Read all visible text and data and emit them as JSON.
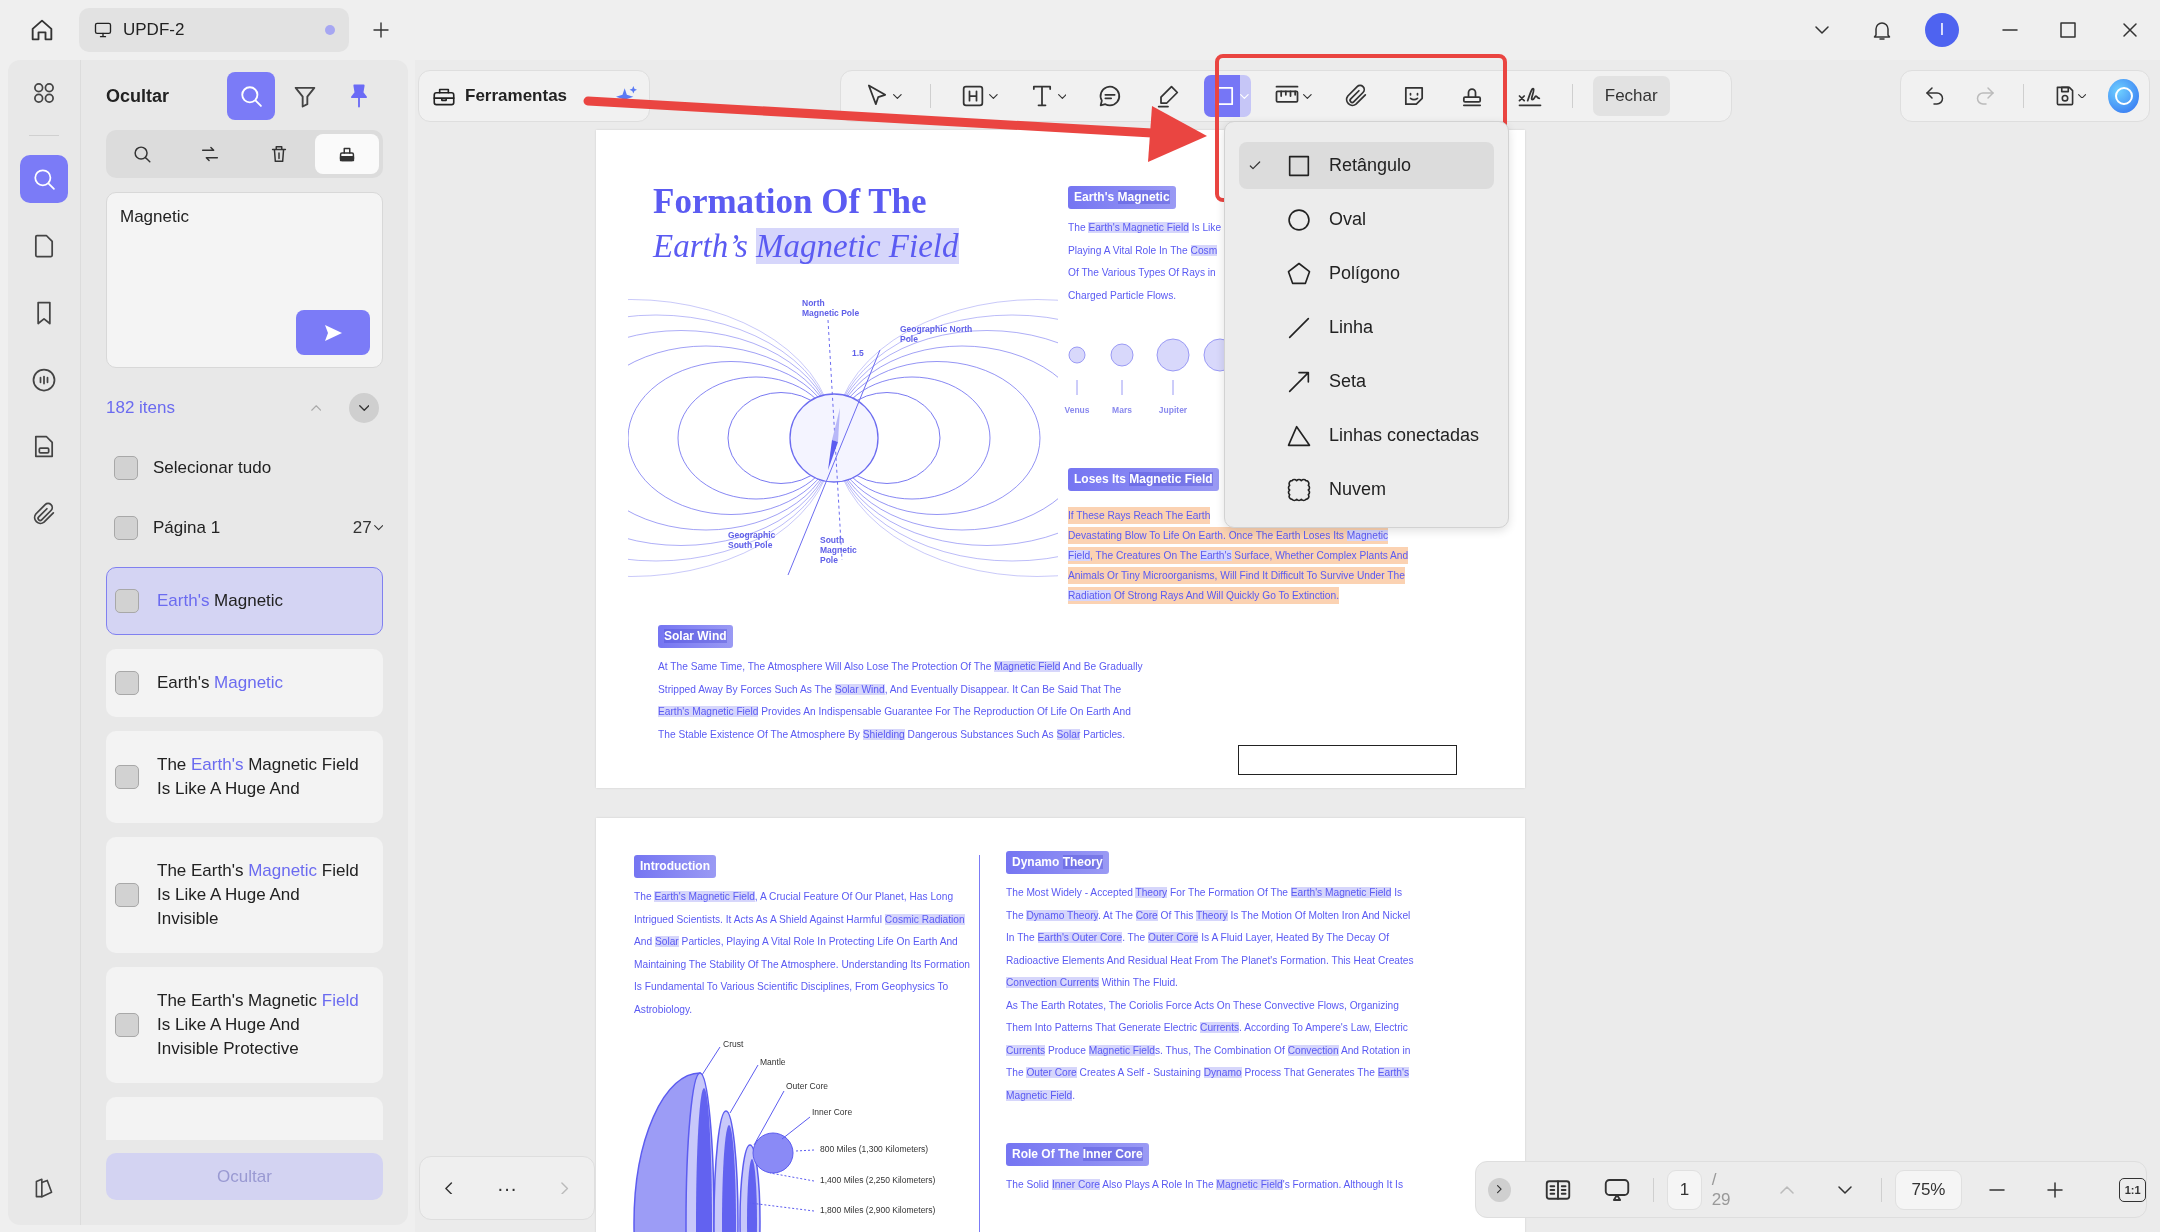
{
  "title_bar": {
    "tab": {
      "title": "UPDF-2",
      "modified": true
    },
    "avatar": "I"
  },
  "rail": {
    "items": [
      {
        "kind": "thumbnails",
        "selected": false
      },
      {
        "kind": "search",
        "selected": true
      },
      {
        "kind": "pages",
        "selected": false
      },
      {
        "kind": "bookmarks",
        "selected": false
      },
      {
        "kind": "comments",
        "selected": false
      },
      {
        "kind": "forms",
        "selected": false
      },
      {
        "kind": "attachments",
        "selected": false
      }
    ]
  },
  "panel": {
    "title": "Ocultar",
    "actions": [
      {
        "kind": "search",
        "selected": true
      },
      {
        "kind": "filter",
        "selected": false
      },
      {
        "kind": "pin",
        "selected": true
      }
    ],
    "modes": [
      {
        "kind": "search",
        "selected": false
      },
      {
        "kind": "replace",
        "selected": false
      },
      {
        "kind": "delete",
        "selected": false
      },
      {
        "kind": "redact",
        "selected": true
      }
    ],
    "query": "Magnetic",
    "count": "182 itens",
    "select_all": {
      "label": "Selecionar tudo",
      "checked": false
    },
    "page_group": {
      "label": "Página 1",
      "count": "27",
      "checked": false
    },
    "results": [
      {
        "segments": [
          {
            "text": "Earth's",
            "match": true
          },
          " Magnetic"
        ],
        "checked": false,
        "selected": true
      },
      {
        "segments": [
          "Earth's ",
          {
            "text": "Magnetic",
            "match": true
          }
        ],
        "checked": false,
        "selected": false
      },
      {
        "segments": [
          "The ",
          {
            "text": "Earth's",
            "match": true
          },
          " Magnetic Field Is Like A Huge And"
        ],
        "checked": false,
        "selected": false
      },
      {
        "segments": [
          "The Earth's ",
          {
            "text": "Magnetic",
            "match": true
          },
          " Field Is Like A Huge And Invisible"
        ],
        "checked": false,
        "selected": false
      },
      {
        "segments": [
          "The Earth's Magnetic ",
          {
            "text": "Field",
            "match": true
          },
          " Is Like A Huge And Invisible Protective"
        ],
        "checked": false,
        "selected": false
      }
    ],
    "hide_button": {
      "label": "Ocultar",
      "disabled": true
    }
  },
  "toolbar": {
    "tools_button": "Ferramentas",
    "tools": [
      {
        "kind": "select",
        "menu": true,
        "selected": false
      },
      {
        "kind": "textbox",
        "menu": true,
        "selected": false
      },
      {
        "kind": "text",
        "menu": true,
        "selected": false
      },
      {
        "kind": "comment",
        "menu": false,
        "selected": false
      },
      {
        "kind": "highlight",
        "menu": false,
        "selected": false
      },
      {
        "kind": "shape",
        "menu": true,
        "selected": true
      },
      {
        "kind": "measure",
        "menu": true,
        "selected": false
      },
      {
        "kind": "attach",
        "menu": false,
        "selected": false
      },
      {
        "kind": "sticker",
        "menu": false,
        "selected": false
      },
      {
        "kind": "stamp",
        "menu": false,
        "selected": false
      },
      {
        "kind": "signature",
        "menu": false,
        "selected": false
      }
    ],
    "close": "Fechar",
    "history": [
      {
        "kind": "undo",
        "disabled": false
      },
      {
        "kind": "redo",
        "disabled": true
      }
    ]
  },
  "shape_menu": {
    "items": [
      {
        "kind": "rectangle",
        "label": "Retângulo",
        "selected": true
      },
      {
        "kind": "oval",
        "label": "Oval",
        "selected": false
      },
      {
        "kind": "polygon",
        "label": "Polígono",
        "selected": false
      },
      {
        "kind": "line",
        "label": "Linha",
        "selected": false
      },
      {
        "kind": "arrow",
        "label": "Seta",
        "selected": false
      },
      {
        "kind": "polyline",
        "label": "Linhas conectadas",
        "selected": false
      },
      {
        "kind": "cloud",
        "label": "Nuvem",
        "selected": false
      }
    ]
  },
  "pages": [
    {
      "kind": "cover",
      "title": "Formation Of The",
      "subtitle": [
        "Earth’s ",
        {
          "text": "Magnetic Field",
          "highlighted": true
        }
      ],
      "field_labels": [
        "North Magnetic Pole",
        "Geographic North Pole",
        "1.5",
        "Geographic South Pole",
        "South Magnetic Pole"
      ],
      "planets": [
        "Venus",
        "Mars",
        "Jupiter"
      ],
      "sections": [
        {
          "heading": [
            "Earth's ",
            {
              "text": "Magnetic",
              "highlighted": true
            }
          ],
          "marked": false,
          "paragraphs": [
            [
              [
                "The ",
                {
                  "text": "Earth's Magnetic Field",
                  "highlighted": true
                },
                " Is Like"
              ],
              [
                "Playing A Vital Role In The ",
                {
                  "text": "Cosm",
                  "highlighted": true
                }
              ],
              [
                "Of The Various Types Of Rays in"
              ],
              [
                "Charged Particle Flows."
              ]
            ]
          ]
        },
        {
          "heading": [
            "Loses Its ",
            {
              "text": "Magnetic Field",
              "highlighted": true
            }
          ],
          "marked": true,
          "paragraphs": [
            [
              [
                "If These Rays Reach The Earth"
              ],
              [
                "Devastating Blow To Life On Earth. Once The Earth Loses Its ",
                {
                  "text": "Magnetic",
                  "highlighted": true
                }
              ],
              [
                {
                  "text": "Field",
                  "highlighted": true
                },
                ", The Creatures On The ",
                {
                  "text": "Earth's",
                  "highlighted": true
                },
                " Surface, Whether Complex Plants And"
              ],
              [
                "Animals Or Tiny Microorganisms, Will Find It Difficult To Survive Under The"
              ],
              [
                {
                  "text": "Radiation",
                  "highlighted": true
                },
                " Of Strong Rays And Will Quickly Go To Extinction."
              ]
            ]
          ]
        },
        {
          "heading": [
            {
              "text": "Solar Wind",
              "highlighted": true
            }
          ],
          "marked": false,
          "paragraphs": [
            [
              [
                "At The Same Time, The Atmosphere Will Also Lose The Protection Of The ",
                {
                  "text": "Magnetic Field",
                  "highlighted": true
                },
                " And Be Gradually"
              ],
              [
                "Stripped Away By Forces Such As The ",
                {
                  "text": "Solar Wind",
                  "highlighted": true
                },
                ", And Eventually Disappear. It Can Be Said That The"
              ],
              [
                {
                  "text": "Earth's Magnetic Field",
                  "highlighted": true
                },
                " Provides An Indispensable Guarantee For The Reproduction Of Life On Earth And"
              ],
              [
                "The Stable Existence Of The Atmosphere By ",
                {
                  "text": "Shielding",
                  "highlighted": true
                },
                " Dangerous Substances Such As ",
                {
                  "text": "Solar",
                  "highlighted": true
                },
                " Particles."
              ]
            ]
          ]
        }
      ]
    },
    {
      "kind": "article",
      "layer_labels": [
        "Crust",
        "Mantle",
        "Outer Core",
        "Inner Core",
        "800 Miles (1,300 Kilometers)",
        "1,400 Miles (2,250 Kilometers)",
        "1,800 Miles (2,900 Kilometers)"
      ],
      "sections": [
        {
          "heading": [
            "Introduction"
          ],
          "marked": false,
          "paragraphs": [
            [
              [
                "The ",
                {
                  "text": "Earth's Magnetic Field",
                  "highlighted": true
                },
                ", A Crucial Feature Of Our Planet, Has Long"
              ],
              [
                "Intrigued Scientists. It Acts As A Shield Against Harmful ",
                {
                  "text": "Cosmic Radiation",
                  "highlighted": true
                }
              ],
              [
                "And ",
                {
                  "text": "Solar",
                  "highlighted": true
                },
                " Particles, Playing A Vital Role In Protecting Life On Earth And"
              ],
              [
                "Maintaining The Stability Of The Atmosphere. Understanding Its Formation"
              ],
              [
                "Is Fundamental To Various Scientific Disciplines, From Geophysics To"
              ],
              [
                "Astrobiology."
              ]
            ]
          ]
        },
        {
          "heading": [
            "Dynamo ",
            {
              "text": "Theory",
              "highlighted": true
            }
          ],
          "marked": false,
          "paragraphs": [
            [
              [
                "The Most Widely - Accepted ",
                {
                  "text": "Theory",
                  "highlighted": true
                },
                " For The Formation Of The ",
                {
                  "text": "Earth's Magnetic Field",
                  "highlighted": true
                },
                " Is"
              ],
              [
                "The ",
                {
                  "text": "Dynamo Theory",
                  "highlighted": true
                },
                ". At The ",
                {
                  "text": "Core",
                  "highlighted": true
                },
                " Of This ",
                {
                  "text": "Theory",
                  "highlighted": true
                },
                " Is The Motion Of Molten Iron And Nickel"
              ],
              [
                "In The ",
                {
                  "text": "Earth's Outer Core",
                  "highlighted": true
                },
                ". The ",
                {
                  "text": "Outer Core",
                  "highlighted": true
                },
                " Is A Fluid Layer, Heated By The Decay Of"
              ],
              [
                "Radioactive Elements And Residual Heat From The Planet's Formation. This Heat Creates"
              ],
              [
                {
                  "text": "Convection Currents",
                  "highlighted": true
                },
                " Within The Fluid."
              ]
            ],
            [
              [
                "As The Earth Rotates, The Coriolis Force Acts On These Convective Flows, Organizing"
              ],
              [
                "Them Into Patterns That Generate Electric ",
                {
                  "text": "Currents",
                  "highlighted": true
                },
                ". According To Ampere's Law, Electric"
              ],
              [
                {
                  "text": "Currents",
                  "highlighted": true
                },
                " Produce ",
                {
                  "text": "Magnetic Field",
                  "highlighted": true
                },
                "s. Thus, The Combination Of ",
                {
                  "text": "Convection",
                  "highlighted": true
                },
                " And Rotation in"
              ],
              [
                "The ",
                {
                  "text": "Outer Core",
                  "highlighted": true
                },
                " Creates A Self - Sustaining ",
                {
                  "text": "Dynamo",
                  "highlighted": true
                },
                " Process That Generates The ",
                {
                  "text": "Earth's",
                  "highlighted": true
                }
              ],
              [
                {
                  "text": "Magnetic Field",
                  "highlighted": true
                },
                "."
              ]
            ]
          ]
        },
        {
          "heading": [
            "Role Of The ",
            {
              "text": "Inner Core",
              "highlighted": true
            }
          ],
          "marked": false,
          "paragraphs": [
            [
              [
                "The Solid ",
                {
                  "text": "Inner Core",
                  "highlighted": true
                },
                " Also Plays A Role In The ",
                {
                  "text": "Magnetic Field",
                  "highlighted": true
                },
                "'s Formation. Although It Is"
              ]
            ]
          ]
        }
      ]
    }
  ],
  "pager": {
    "more": "···",
    "next_disabled": true
  },
  "view_bar": {
    "page": "1",
    "total": "/ 29",
    "prev_disabled": true,
    "zoom": "75%",
    "actual_size": "1:1"
  }
}
